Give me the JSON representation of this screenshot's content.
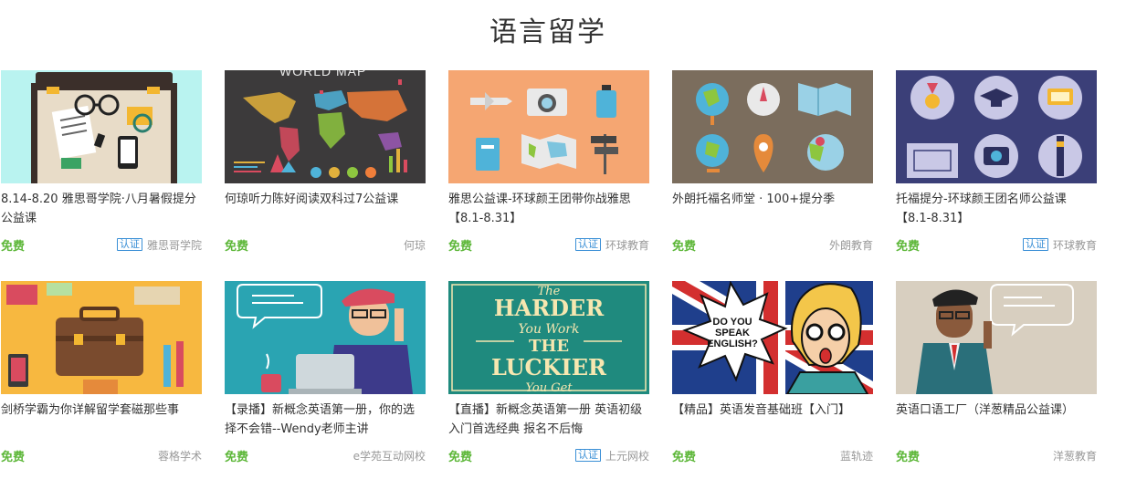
{
  "section": {
    "title": "语言留学"
  },
  "courses": [
    {
      "title": "8.14-8.20 雅思哥学院·八月暑假提分公益课",
      "price": "免费",
      "badge": "认证",
      "org": "雅思哥学院"
    },
    {
      "title": "何琼听力陈好阅读双科过7公益课",
      "price": "免费",
      "badge": "",
      "org": "何琼"
    },
    {
      "title": "雅思公益课-环球颜王团带你战雅思【8.1-8.31】",
      "price": "免费",
      "badge": "认证",
      "org": "环球教育"
    },
    {
      "title": "外朗托福名师堂 · 100+提分季",
      "price": "免费",
      "badge": "",
      "org": "外朗教育"
    },
    {
      "title": "托福提分-环球颜王团名师公益课【8.1-8.31】",
      "price": "免费",
      "badge": "认证",
      "org": "环球教育"
    },
    {
      "title": "剑桥学霸为你详解留学套磁那些事",
      "price": "免费",
      "badge": "",
      "org": "蓉格学术"
    },
    {
      "title": "【录播】新概念英语第一册，你的选择不会错--Wendy老师主讲",
      "price": "免费",
      "badge": "",
      "org": "e学苑互动网校"
    },
    {
      "title": "【直播】新概念英语第一册 英语初级入门首选经典 报名不后悔",
      "price": "免费",
      "badge": "认证",
      "org": "上元网校"
    },
    {
      "title": "【精品】英语发音基础班【入门】",
      "price": "免费",
      "badge": "",
      "org": "蓝轨迹"
    },
    {
      "title": "英语口语工厂（洋葱精品公益课）",
      "price": "免费",
      "badge": "",
      "org": "洋葱教育"
    }
  ],
  "thumb_text": {
    "world_map": "WORLD MAP",
    "poster": [
      "The",
      "HARDER",
      "You Work",
      "THE",
      "LUCKIER",
      "You Get"
    ],
    "speech": [
      "DO YOU",
      "SPEAK",
      "ENGLISH?"
    ]
  },
  "colors": {
    "free": "#5db739",
    "verified": "#3a8fd6",
    "muted": "#999999"
  }
}
